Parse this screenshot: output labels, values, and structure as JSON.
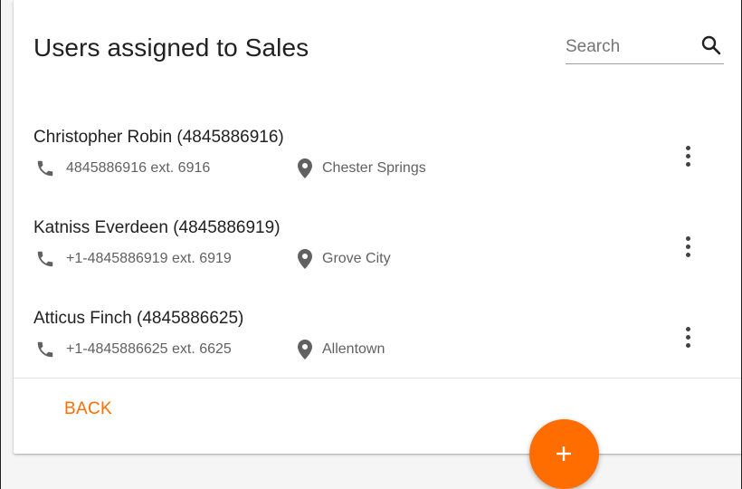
{
  "header": {
    "title": "Users assigned to Sales"
  },
  "search": {
    "placeholder": "Search",
    "value": "",
    "icon": "search-icon"
  },
  "users": [
    {
      "name": "Christopher Robin (4845886916)",
      "phone": "4845886916 ext. 6916",
      "location": "Chester Springs"
    },
    {
      "name": "Katniss Everdeen (4845886919)",
      "phone": "+1-4845886919 ext. 6919",
      "location": "Grove City"
    },
    {
      "name": "Atticus Finch (4845886625)",
      "phone": "+1-4845886625 ext. 6625",
      "location": "Allentown"
    }
  ],
  "footer": {
    "back_label": "BACK"
  },
  "fab": {
    "icon": "plus-icon",
    "symbol": "+"
  },
  "colors": {
    "accent": "#ff6d00",
    "text_primary": "#212121",
    "text_secondary": "#616161",
    "icon": "#616161"
  }
}
